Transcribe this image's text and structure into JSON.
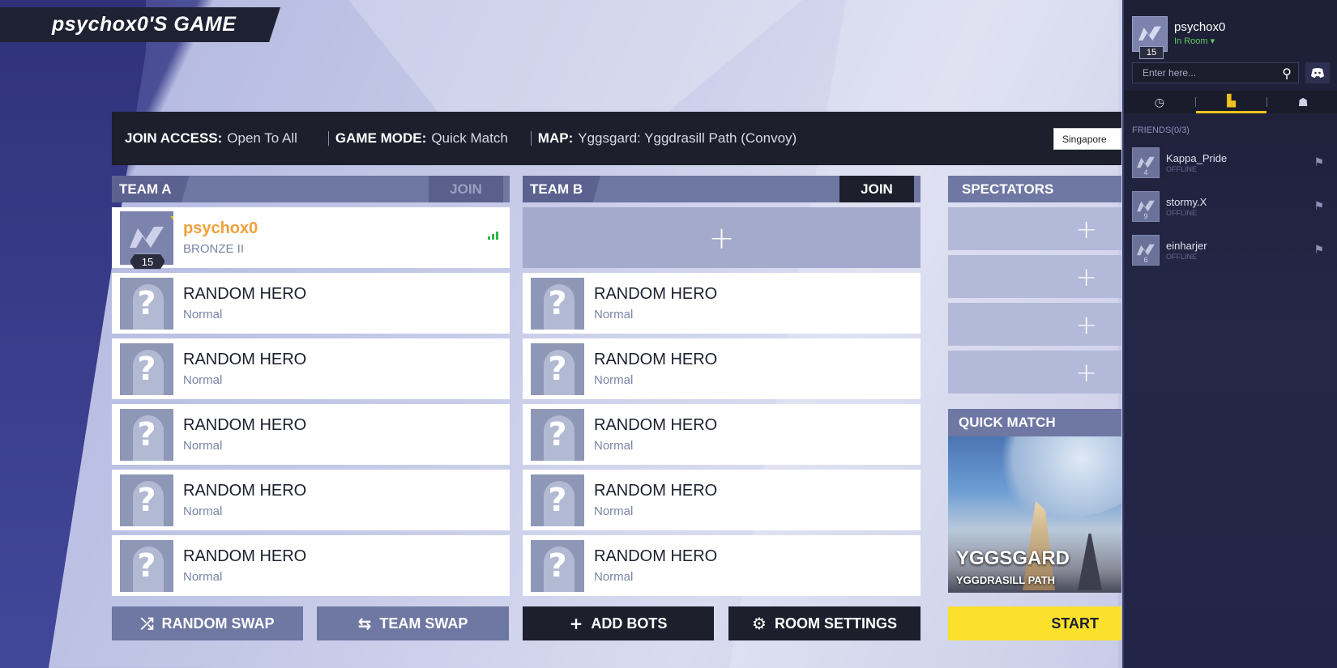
{
  "title": "psychox0'S GAME",
  "info": {
    "join_access_label": "JOIN ACCESS:",
    "join_access_value": "Open To All",
    "game_mode_label": "GAME MODE:",
    "game_mode_value": "Quick Match",
    "map_label": "MAP:",
    "map_value": "Yggsgard: Yggdrasill Path (Convoy)",
    "region": "Singapore"
  },
  "team_a": {
    "name": "TEAM A",
    "join_label": "JOIN",
    "player": {
      "name": "psychox0",
      "rank": "BRONZE II",
      "level": "15"
    },
    "slots": [
      {
        "hero": "RANDOM HERO",
        "difficulty": "Normal"
      },
      {
        "hero": "RANDOM HERO",
        "difficulty": "Normal"
      },
      {
        "hero": "RANDOM HERO",
        "difficulty": "Normal"
      },
      {
        "hero": "RANDOM HERO",
        "difficulty": "Normal"
      },
      {
        "hero": "RANDOM HERO",
        "difficulty": "Normal"
      }
    ]
  },
  "team_b": {
    "name": "TEAM B",
    "join_label": "JOIN",
    "add_slot": "+",
    "slots": [
      {
        "hero": "RANDOM HERO",
        "difficulty": "Normal"
      },
      {
        "hero": "RANDOM HERO",
        "difficulty": "Normal"
      },
      {
        "hero": "RANDOM HERO",
        "difficulty": "Normal"
      },
      {
        "hero": "RANDOM HERO",
        "difficulty": "Normal"
      },
      {
        "hero": "RANDOM HERO",
        "difficulty": "Normal"
      }
    ]
  },
  "spectators": {
    "title": "SPECTATORS",
    "slots": [
      "+",
      "+",
      "+",
      "+"
    ]
  },
  "quick_match": {
    "title": "QUICK MATCH",
    "map_title": "YGGSGARD",
    "map_subtitle": "YGGDRASILL PATH"
  },
  "buttons": {
    "random_swap": "RANDOM SWAP",
    "team_swap": "TEAM SWAP",
    "add_bots": "ADD BOTS",
    "room_settings": "ROOM SETTINGS",
    "start": "START"
  },
  "social": {
    "username": "psychox0",
    "status": "In Room",
    "level": "15",
    "search_placeholder": "Enter here...",
    "friends_header": "FRIENDS(0/3)",
    "friends": [
      {
        "name": "Kappa_Pride",
        "status": "OFFLINE",
        "level": "4"
      },
      {
        "name": "stormy.X",
        "status": "OFFLINE",
        "level": "9"
      },
      {
        "name": "einharjer",
        "status": "OFFLINE",
        "level": "6"
      }
    ]
  },
  "colors": {
    "accent_yellow": "#fbe02c",
    "dark": "#1d1f2c",
    "slate": "#6f77a3",
    "player_name": "#f0a13a"
  }
}
